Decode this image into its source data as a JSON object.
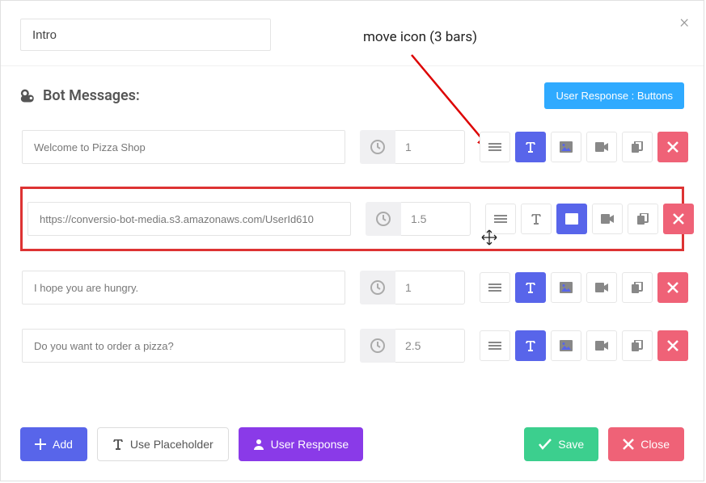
{
  "title_value": "Intro",
  "section_title": "Bot Messages:",
  "user_response_btn": "User Response : Buttons",
  "annotation": "move icon (3 bars)",
  "messages": [
    {
      "text": "Welcome to Pizza Shop",
      "delay": "1",
      "active_tool": "text",
      "highlighted": false
    },
    {
      "text": "https://conversio-bot-media.s3.amazonaws.com/UserId610",
      "delay": "1.5",
      "active_tool": "image",
      "highlighted": true
    },
    {
      "text": "I hope you are hungry.",
      "delay": "1",
      "active_tool": "text",
      "highlighted": false
    },
    {
      "text": "Do you want to order a pizza?",
      "delay": "2.5",
      "active_tool": "text",
      "highlighted": false
    }
  ],
  "footer": {
    "add": "Add",
    "placeholder": "Use Placeholder",
    "user_response": "User Response",
    "save": "Save",
    "close": "Close"
  }
}
